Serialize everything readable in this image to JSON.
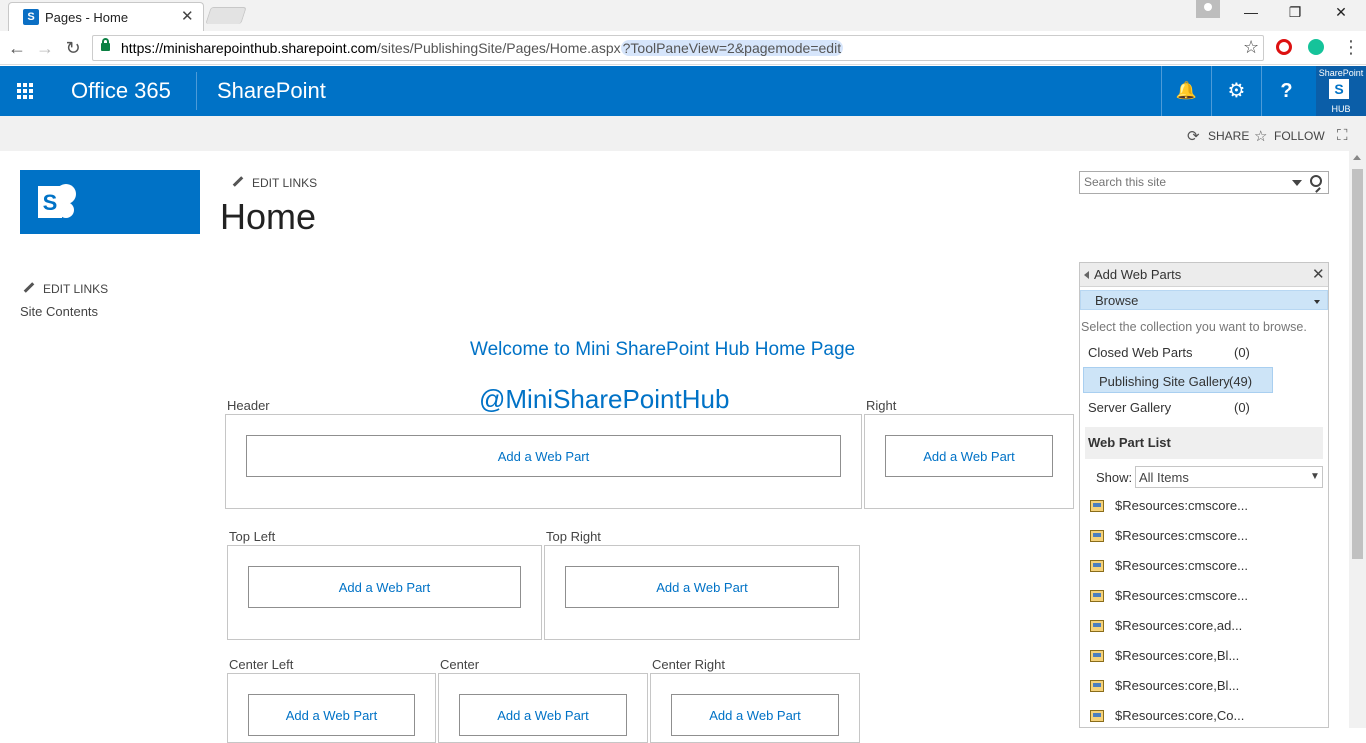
{
  "browser": {
    "tab_title": "Pages - Home",
    "tab_close": "✕",
    "url_host": "https://minisharepointhub.sharepoint.com",
    "url_path": "/sites/PublishingSite/Pages/Home.aspx",
    "url_query": "?ToolPaneView=2&pagemode=edit",
    "window_controls": {
      "minimize": "—",
      "restore": "❐",
      "close": "✕"
    },
    "nav": {
      "back": "←",
      "forward": "→",
      "reload": "↻"
    },
    "star": "☆",
    "menu": "⋮"
  },
  "suite_bar": {
    "brand": "Office 365",
    "app_name": "SharePoint",
    "icons": {
      "bell": "🔔",
      "gear": "⚙",
      "help": "?"
    },
    "hub_logo": {
      "top": "SharePoint",
      "mark": "S",
      "bottom": "HUB"
    }
  },
  "ribbon": {
    "share": "SHARE",
    "follow": "FOLLOW",
    "share_glyph": "⟳",
    "follow_glyph": "☆",
    "focus_glyph": "⛶"
  },
  "site": {
    "top_edit_links": "EDIT LINKS",
    "left_edit_links": "EDIT LINKS",
    "page_title": "Home",
    "quick_launch": [
      "Site Contents"
    ],
    "search_placeholder": "Search this site"
  },
  "content": {
    "welcome": "Welcome to Mini SharePoint Hub Home Page",
    "handle": "@MiniSharePointHub",
    "add_web_part": "Add a Web Part",
    "zones": {
      "header": "Header",
      "right": "Right",
      "top_left": "Top Left",
      "top_right": "Top Right",
      "center_left": "Center Left",
      "center": "Center",
      "center_right": "Center Right"
    }
  },
  "toolpane": {
    "title": "Add Web Parts",
    "close": "✕",
    "browse": "Browse",
    "instruction": "Select the collection you want to browse.",
    "collections": [
      {
        "name": "Closed Web Parts",
        "count": "(0)"
      },
      {
        "name": "Publishing Site Gallery",
        "count": "(49)"
      },
      {
        "name": "Server Gallery",
        "count": "(0)"
      }
    ],
    "web_part_list_title": "Web Part List",
    "show_label": "Show:",
    "show_value": "All Items",
    "show_arrow": "▼",
    "items": [
      "$Resources:cmscore...",
      "$Resources:cmscore...",
      "$Resources:cmscore...",
      "$Resources:cmscore...",
      "$Resources:core,ad...",
      "$Resources:core,Bl...",
      "$Resources:core,Bl...",
      "$Resources:core,Co..."
    ]
  }
}
